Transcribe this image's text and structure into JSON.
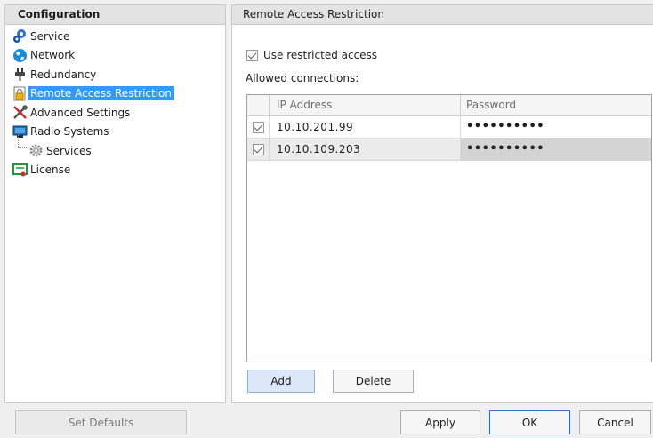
{
  "left_panel": {
    "title": "Configuration",
    "items": [
      {
        "label": "Service",
        "icon": "gears-icon"
      },
      {
        "label": "Network",
        "icon": "globe-icon"
      },
      {
        "label": "Redundancy",
        "icon": "plug-icon"
      },
      {
        "label": "Remote Access Restriction",
        "icon": "lock-document-icon",
        "selected": true
      },
      {
        "label": "Advanced Settings",
        "icon": "tools-icon"
      },
      {
        "label": "Radio Systems",
        "icon": "monitor-icon"
      },
      {
        "label": "Services",
        "icon": "gear-icon",
        "child": true
      },
      {
        "label": "License",
        "icon": "license-icon"
      }
    ]
  },
  "right_panel": {
    "title": "Remote Access Restriction",
    "use_restricted_label": "Use restricted access",
    "use_restricted_checked": true,
    "allowed_label": "Allowed connections:",
    "columns": [
      "IP Address",
      "Password"
    ],
    "rows": [
      {
        "checked": true,
        "ip": "10.10.201.99",
        "password": "••••••••••"
      },
      {
        "checked": true,
        "ip": "10.10.109.203",
        "password": "••••••••••",
        "selected": true
      }
    ],
    "add_label": "Add",
    "delete_label": "Delete"
  },
  "footer": {
    "set_defaults_label": "Set Defaults",
    "apply_label": "Apply",
    "ok_label": "OK",
    "cancel_label": "Cancel"
  },
  "colors": {
    "selection": "#3399ff",
    "header_bg": "#e3e3e3"
  }
}
